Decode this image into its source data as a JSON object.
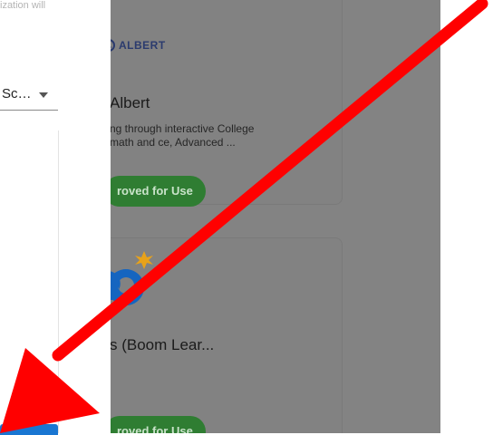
{
  "left_panel": {
    "note_text": "ization will",
    "select": {
      "value": "Sc…",
      "icon": "chevron-down-icon"
    },
    "primary_button_label": "",
    "colors": {
      "button": "#1976d2"
    }
  },
  "cards": [
    {
      "logo_text": "ALBERT",
      "title": "Albert",
      "description": "ng through interactive College math and ce, Advanced ...",
      "chip_label": "roved for Use"
    },
    {
      "logo": "boom-learning-logo",
      "title": "s (Boom Lear...",
      "description": "",
      "chip_label": "roved for Use"
    }
  ],
  "overlay": {
    "arrow_color": "#ff0000",
    "arrow_icon": "red-arrow-icon"
  },
  "colors": {
    "overlay_gray": "#838383",
    "chip_green": "#2f7d32",
    "albert_navy": "#2b3b6e",
    "boom_blue": "#1565c0",
    "boom_star": "#e8a21a"
  }
}
